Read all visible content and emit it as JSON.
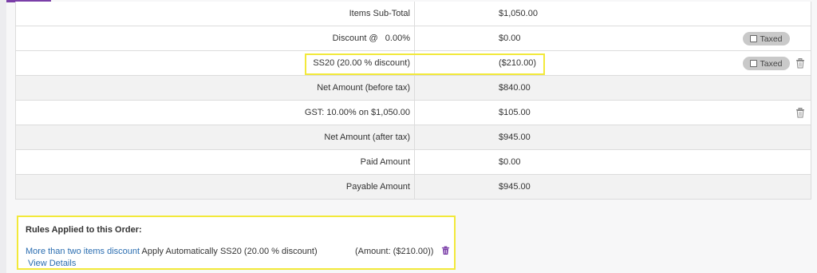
{
  "summary": {
    "rows": [
      {
        "label": "Items Sub-Total",
        "amount": "$1,050.00",
        "taxed": null,
        "delete": false
      },
      {
        "label": "Discount @   0.00%",
        "amount": "$0.00",
        "taxed": "Taxed",
        "delete": false
      },
      {
        "label": "SS20 (20.00 % discount)",
        "amount": "($210.00)",
        "taxed": "Taxed",
        "delete": true
      },
      {
        "label": "Net Amount (before tax)",
        "amount": "$840.00",
        "taxed": null,
        "delete": false
      },
      {
        "label": "GST: 10.00% on $1,050.00",
        "amount": "$105.00",
        "taxed": null,
        "delete": true
      },
      {
        "label": "Net Amount (after tax)",
        "amount": "$945.00",
        "taxed": null,
        "delete": false
      },
      {
        "label": "Paid Amount",
        "amount": "$0.00",
        "taxed": null,
        "delete": false
      },
      {
        "label": "Payable Amount",
        "amount": "$945.00",
        "taxed": null,
        "delete": false
      }
    ]
  },
  "rules": {
    "title": "Rules Applied to this Order:",
    "rule_name": "More than two items discount",
    "rule_text": " Apply Automatically SS20 (20.00 % discount)",
    "rule_amount": "(Amount: ($210.00))",
    "view_details": "View Details"
  },
  "colors": {
    "accent": "#7b3fa8",
    "highlight": "#f2e93a",
    "link": "#2a6db0",
    "pill": "#c9c9c9"
  },
  "icons": {
    "trash": "trash-icon",
    "checkbox": "checkbox-icon"
  }
}
